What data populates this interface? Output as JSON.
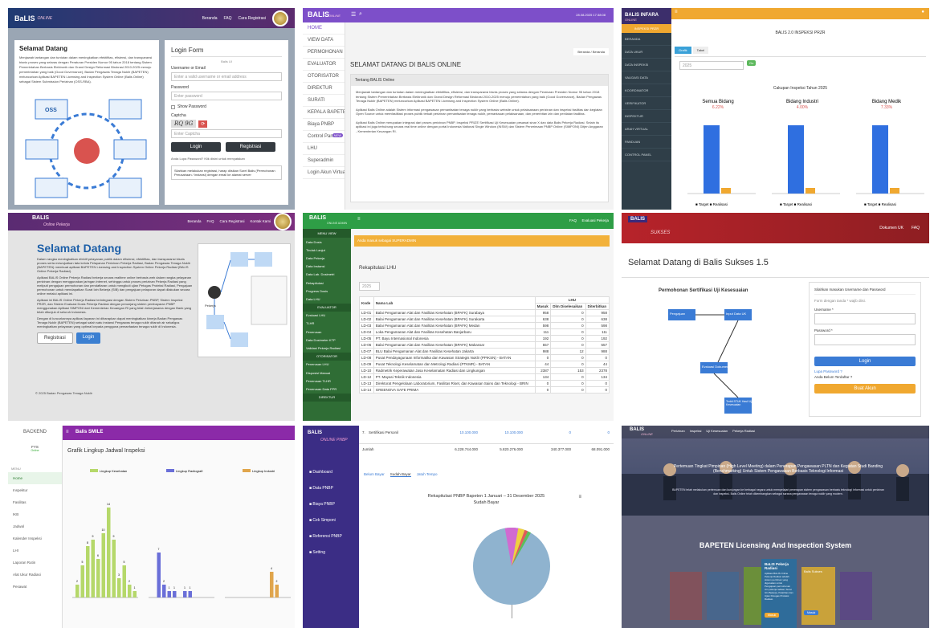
{
  "t1": {
    "logo": "BaLIS",
    "logo_sub": "ONLINE",
    "nav": [
      "Beranda",
      "FAQ",
      "Cara Registrasi"
    ],
    "welcome": "Selamat Datang",
    "intro": "Menjawab tantangan dan tuntutan dalam meningkatkan efektifitas, efisiensi, dan transparansi bisnis proses yang selaras dengan Peraturan Presiden Nomor 95 tahun 2018 tentang Sistem Pemerintahan Berbasis Elektronik dan Grand Design Reformasi Birokrasi 2010-2025 menuju pemerintahan yang baik (Good Governance), Badan Pengawas Tenaga Nuklir (BAPETEN) meluncurkan Aplikasi BAPETEN Licensing and Inspection System Online (Balis Online) sebagai Sistem Submission Perizinan (OSS-RBA).",
    "oss": "OSS",
    "login_title": "Login Form",
    "login_sub": "Balis UI",
    "user_label": "Username or Email",
    "user_ph": "Enter a valid username or email address",
    "pass_label": "Password",
    "pass_ph": "Enter password",
    "remember": "Show Password",
    "captcha_label": "Captcha",
    "captcha_text": "RQ 9G",
    "captcha_ph": "Enter Captcha",
    "login_btn": "Login",
    "register_btn": "Registrasi",
    "forgot": "Anda Lupa Password? Klik disini untuk menyatakan",
    "notice": "Silahkan melakukan registrasi, harap diisikan Surel Balis (Permohonan Perusahaan / Instansi) dengan email ke alamat server"
  },
  "t2": {
    "logo": "BALIS",
    "logo_sub": "ONLINE",
    "topbar_right": "28.08.2025 17:38:08",
    "sidebar": [
      "HOME",
      "VIEW DATA",
      "PERMOHONAN",
      "EVALUATOR",
      "OTORISATOR",
      "DIREKTUR",
      "SURATI",
      "KEPALA BAPETEN",
      "Biaya PNBP",
      "Control Panel",
      "LHU",
      "Superadmin",
      "Login Akun Virtual"
    ],
    "cp_badge": "NEW",
    "page_title": "SELAMAT DATANG DI BALIS ONLINE",
    "breadcrumb": "Beranda / Beranda",
    "panel_head": "Tentang BALIS Online",
    "para1": "Menjawab tantangan dan tuntutan dalam meningkatkan efektifitas, efisiensi, dan transparansi bisnis proses yang selaras dengan Peraturan Presiden Nomor 95 tahun 2018 tentang Sistem Pemerintahan Berbasis Elektronik dan Grand Design Reformasi Birokrasi 2010-2025 menuju pemerintahan yang baik (Good Governance), Badan Pengawas Tenaga Nuklir (BAPETEN) meluncurkan Aplikasi BAPETEN Licensing and Inspection System Online (Balis Online).",
    "para2": "Aplikasi Balis Online adalah Sistem informasi pengawasan pemanfaatan tenaga nuklir yang berbasis website untuk pelaksanaan perizinan dan inspeksi fasilitas dan kegiatan Open Source untuk memfasilitasi proses publik terkait perizinan pemanfaatan tenaga nuklir, pemantauan pelaksanaan, dan penerbitan izin dan penilaian fasilitas.",
    "para3": "Aplikasi Balis Online merupakan integrasi dari proses perizinan PNBP, Inspeksi PRIZE Sertifikasi Uji Kesesuaian pesawat sinar X dan data Balis Pekerja Radiasi. Selain itu aplikasi ini juga terhubung secara real time online dengan portal Indonesia National Single Window (INSW) dan Sistem Penerimaan PNBP Online (SIMPONI) Ditjen Anggaran - Kementerian Keuangan RI."
  },
  "t3": {
    "logo": "BALIS INFARA",
    "logo_sub": "ONLINE",
    "sidebar_head": "INSPEKSI PRZR",
    "sidebar": [
      "BERANDA",
      "DATA UKUR",
      "DATA INSPEKSI",
      "VALIDASI DATA",
      "KOORDINATOR",
      "VERIFIKATOR",
      "INSPEKTUR",
      "ARAH VIRTUAL",
      "PANDUAN",
      "CONTROL PANEL"
    ],
    "page_title": "BALIS 2.0 INSPEKSI PRZR",
    "tabs": [
      "Grafik",
      "Tabel"
    ],
    "year": "2025",
    "go": "Go",
    "chart_title": "Cakupan Inspeksi Tahun 2025"
  },
  "t4": {
    "logo": "BALIS",
    "logo_sub": "Online Pekerja",
    "nav": [
      "Beranda",
      "FAQ",
      "Cara Registrasi",
      "Kontak Kami"
    ],
    "welcome": "Selamat Datang",
    "p1": "Dalam rangka meningkatkan efektif pelayanan publik dalam efisiensi, efektifitas, dan transparansi bisnis proses serta mewujudkan tata kelola Pelayanan Perizinan Pekerja Radiasi, Badan Pengawas Tenaga Nuklir (BAPETEN) membuat aplikasi BAPETEN Licensing and Inspection System Online Pekerja Radiasi (BALIS Online Pekerja Radiasi).",
    "p2": "Aplikasi BALIS Online Pekerja Radiasi bekerja secara realtime online berbasis web dalam rangka pelayanan perizinan dengan menggunakan jaringan internet, sehingga untuk proses perizinan Pekerja Radiasi yang meliputi pengajuan permohonan dan pendaftaran untuk mengikuti ujian Petugas Proteksi Radiasi, Pengajuan permohonan untuk mendapatkan Surat Izin Bekerja (SIB) dan pengajuan pelaporan dapat dilakukan secara online melalui aplikasi ini.",
    "p3": "Aplikasi ini BALIS Online Pekerja Radiasi terintegrasi dengan Sistem Perizinan PNBP, Sistem Inspeksi PRZR, dan Sistem Evaluasi Dosis Pekerja Radiasi dengan penunjang sistem pembayaran PNBP menggunakan Aplikasi SIMPONI dari Kementerian Keuangan RI yang telah bekerjasama dengan Bank yang telah ditunjuk di seluruh Indonesia.",
    "p4": "Dengan di luncurkannya aplikasi layanan ini diharapkan dapat meningkatkan kinerja Badan Pengawas Tenaga Nuklir (BAPETEN) sebagai salah satu instansi Pengawas tenaga nuklir ditanah air sekaligus meningkatkan pelayanan yang optimal kepada pengguna pemanfaatan tenaga nuklir di Indonesia.",
    "reg_btn": "Registrasi",
    "login_btn": "Login",
    "footer": "© 2025 Badan Pengawas Tenaga Nuklir",
    "worker": "Pekerja"
  },
  "t5": {
    "logo": "BALIS",
    "logo_sub": "ONLINE ADMIN",
    "topbar": [
      "FAQ",
      "Evaluasi Pekerja"
    ],
    "sidebar_head": "MENU VIEW",
    "sidebar": [
      "Data Dosis",
      "Tindak Lanjut",
      "Data Pekerja",
      "Data Instansi",
      "Data Lab. Dosimetri",
      "Rekapitulasi",
      "Progress Dosis",
      "Data LHU",
      "EVALUATOR",
      "Evaluasi LHU",
      "TLHR",
      "Penerusan",
      "Data Dosimeter KTP",
      "Validasi Pekerja Radiasi",
      "OTORISATOR",
      "Penerusan LHU",
      "Disposisi Manual",
      "Penerusan TLHR",
      "Penerusan Data PPR",
      "DIREKTUR"
    ],
    "alert": "Anda masuk sebagai SUPERADMIN",
    "section": "Rekapitulasi LHU",
    "year": "2025",
    "cols": [
      "Kode",
      "Nama Lab",
      "Masuk",
      "Dlm Diselesaikan",
      "Diterbitkan"
    ],
    "lhu_head": "LHU",
    "rows": [
      [
        "LD-01",
        "Balai Pengamanan Alat dan Fasilitas Kesehatan (BPAFK) Surabaya",
        "958",
        "0",
        "958"
      ],
      [
        "LD-02",
        "Balai Pengamanan Alat dan Fasilitas Kesehatan (BPAFK) Surakarta",
        "638",
        "0",
        "638"
      ],
      [
        "LD-03",
        "Balai Pengamanan Alat dan Fasilitas Kesehatan (BPAFK) Medan",
        "598",
        "0",
        "598"
      ],
      [
        "LD-04",
        "Loka Pengamanan Alat dan Fasilitas Kesehatan Banjarbaru",
        "111",
        "0",
        "111"
      ],
      [
        "LD-05",
        "PT. Bayu Internasional Indonesia",
        "192",
        "0",
        "192"
      ],
      [
        "LD-06",
        "Balai Pengamanan Alat dan Fasilitas Kesehatan (BPAFK) Makassar",
        "557",
        "0",
        "557"
      ],
      [
        "LD-07",
        "BLU Balai Pengamanan Alat dan Fasilitas Kesehatan Jakarta",
        "988",
        "12",
        "988"
      ],
      [
        "LD-08",
        "Pusat Pendayagunaan Informatika dan Kawasan Strategis Nuklir (PPIKSN) - BATAN",
        "0",
        "0",
        "0"
      ],
      [
        "LD-09",
        "Pusat Teknologi Keselamatan dan Metrologi Radiasi (PTKMR) - BATAN",
        "44",
        "0",
        "44"
      ],
      [
        "LD-10",
        "Radmetrik Keperawatan Jasa Keselamatan Radiasi dan Lingkungan",
        "2387",
        "153",
        "2378"
      ],
      [
        "LD-12",
        "PT. Mayasi Teknik Indonesia",
        "134",
        "0",
        "134"
      ],
      [
        "LD-13",
        "Direktorat Pengelolaan Laboratorium, Fasilitas Riset, dan Kawasan Sains dan Teknologi - BRIN",
        "0",
        "0",
        "0"
      ],
      [
        "LD-14",
        "GREENOVA SAFE PRIMA",
        "0",
        "0",
        "0"
      ]
    ]
  },
  "t6": {
    "logo": "BALIS",
    "logo_sub": "SUKSES",
    "nav": [
      "Dokumen UK",
      "FAQ"
    ],
    "title": "Selamat Datang di Balis Sukses 1.5",
    "flow_title": "Permohonan Sertifikasi Uji Kesesuaian",
    "steps": [
      "Pengajuan",
      "Input Data UK",
      "Evaluasi Dokumen",
      "Terbit STUK Hasil Uji Kesesuaian"
    ],
    "login_hint": "Silahkan masukan Username dan Password",
    "login_hint2": "Form dengan tanda * wajib diisi.",
    "user_label": "Username *",
    "pass_label": "Password *",
    "login_btn": "Login",
    "forgot": "Lupa Password ?",
    "reg_q": "Anda Belum Terdaftar ?",
    "reg_btn": "Buat Akun"
  },
  "t7": {
    "brand": "BACKEND",
    "topbar": "Balis SMILE",
    "user": "FYS",
    "status": "Online",
    "menu_head": "MENU",
    "menu": [
      "Home",
      "Inspektur",
      "Fasilitas",
      "IKB",
      "Jadwal",
      "Kalender Inspeksi",
      "LHI",
      "Laporan Rutin",
      "Alat Ukur Radiasi",
      "Pesawat"
    ],
    "title": "Grafik Lingkup Jadwal Inspeksi",
    "legends": [
      "Lingkup Kesehatan",
      "Lingkup Radiografi",
      "Lingkup Industri"
    ],
    "colors": [
      "#b5d86a",
      "#6a6fd8",
      "#e0a54c"
    ]
  },
  "t8": {
    "logo": "BALIS",
    "logo_sub": "ONLINE PNBP",
    "sidebar": [
      "Dashboard",
      "Data PNBP",
      "Biaya PNBP",
      "Cek Simponi",
      "Referensi PNBP",
      "Setting"
    ],
    "row7": [
      "7.",
      "Sertifikasi Personil",
      "10.100.000",
      "10.100.000",
      "0",
      "0"
    ],
    "total": [
      "Jumlah",
      "6.228.744.000",
      "5.820.276.000",
      "340.377.000",
      "68.091.000"
    ],
    "tabs": [
      "Belum Bayar",
      "Sudah Bayar",
      "Jatuh Tempo"
    ],
    "chart_title": "Rekapitulasi PNBP Bapeten 1 Januari – 31 Desember 2025",
    "chart_sub": "Sudah Bayar"
  },
  "t9": {
    "logo": "BALIS",
    "logo_sub": "ONLINE",
    "nav": [
      "Perizinan",
      "Inspeksi",
      "Uji Kesesuaian",
      "Pekerja Radiasi"
    ],
    "caption": "Pertemuan Tingkat Pimpinan (High Level Meeting) dalam Penerapan Pengawasan PLTN dan Kegiatan Studi Banding (Benchmarking) Untuk Sistem Pengawasan Berbasis Teknologi Informasi",
    "caption2": "BAPETEN telah melakukan pertemuan dan kunjungan ke berbagai negara untuk mempelajari penerapan sistem pengawasan berbasis teknologi informasi untuk perizinan dan inspeksi. Balis Online telah dikembangkan sebagai sarana pengawasan tenaga nuklir yang modern.",
    "heading": "BAPETEN Licensing And Inspection System",
    "card_title": "BaLIS Pekerja Radiasi",
    "card_text": "Aplikasi BALIS Online Pekerja Radiasi adalah sistem perizinan yang digunakan untuk Pengajuan permohonan izin pekerja radiasi, Surat Izin Bekerja, Pelatihan dan Ujian Petugas Proteksi Radiasi.",
    "card_btn": "Masuk",
    "card2": "Balis Sukses",
    "card_btn_small": "Masuk"
  }
}
